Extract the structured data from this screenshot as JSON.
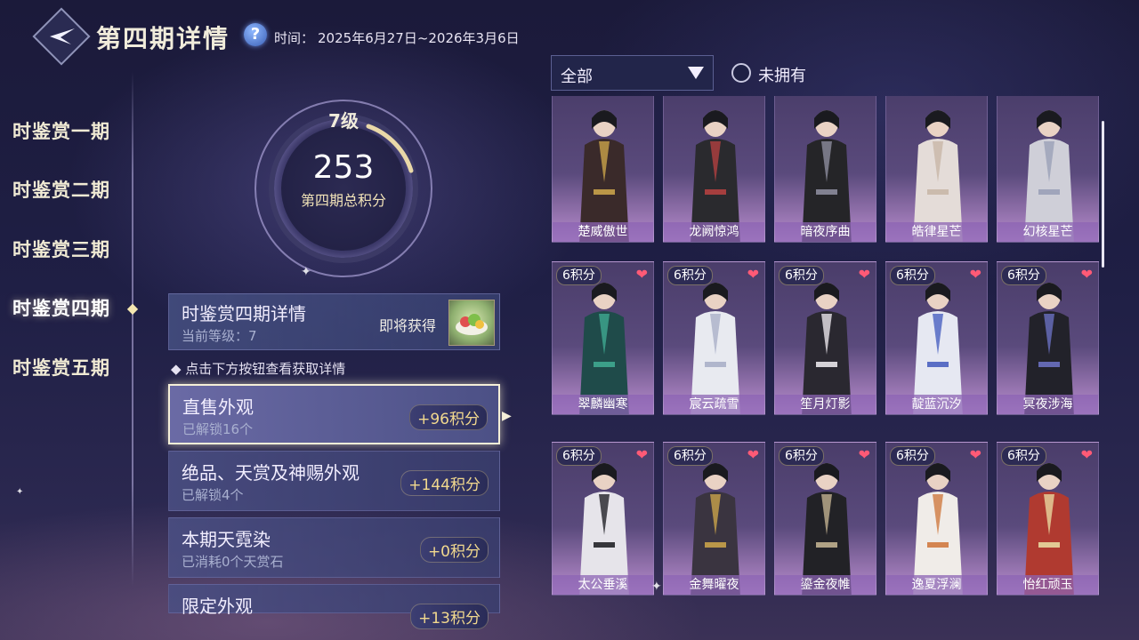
{
  "header": {
    "title": "第四期详情",
    "help_icon": "?",
    "time_label": "时间：",
    "time_range": "2025年6月27日~2026年3月6日"
  },
  "periods": [
    {
      "label": "时鉴赏一期",
      "active": false
    },
    {
      "label": "时鉴赏二期",
      "active": false
    },
    {
      "label": "时鉴赏三期",
      "active": false
    },
    {
      "label": "时鉴赏四期",
      "active": true
    },
    {
      "label": "时鉴赏五期",
      "active": false
    }
  ],
  "ring": {
    "level": "7级",
    "score": "253",
    "caption": "第四期总积分"
  },
  "detail": {
    "title": "时鉴赏四期详情",
    "sub": "当前等级：7",
    "soon": "即将获得",
    "reward_icon": "food-plate-icon"
  },
  "hint": "◆ 点击下方按钮查看获取详情",
  "categories": [
    {
      "title": "直售外观",
      "sub": "已解锁16个",
      "badge": "+96积分",
      "selected": true
    },
    {
      "title": "绝品、天赏及神赐外观",
      "sub": "已解锁4个",
      "badge": "+144积分",
      "selected": false
    },
    {
      "title": "本期天霓染",
      "sub": "已消耗0个天赏石",
      "badge": "+0积分",
      "selected": false
    },
    {
      "title": "限定外观",
      "sub": "",
      "badge": "+13积分",
      "selected": false
    }
  ],
  "filter": {
    "value": "全部",
    "radio_label": "未拥有"
  },
  "grid": {
    "rows": [
      [
        {
          "name": "楚威傲世",
          "points": "",
          "outfit": "#3a2a2a",
          "accent": "#c9a24a"
        },
        {
          "name": "龙阙惊鸿",
          "points": "",
          "outfit": "#2a2a2e",
          "accent": "#b24040"
        },
        {
          "name": "暗夜序曲",
          "points": "",
          "outfit": "#252528",
          "accent": "#8c8c9c"
        },
        {
          "name": "皓律星芒",
          "points": "",
          "outfit": "#e4dcd8",
          "accent": "#c8b7a8"
        },
        {
          "name": "幻核星芒",
          "points": "",
          "outfit": "#cfcfd8",
          "accent": "#9aa0b8"
        }
      ],
      [
        {
          "name": "翠麟幽寒",
          "points": "6积分",
          "outfit": "#1f4b4a",
          "accent": "#3fa890"
        },
        {
          "name": "宸云疏雪",
          "points": "6积分",
          "outfit": "#e8eaf0",
          "accent": "#aab0c8"
        },
        {
          "name": "笙月灯影",
          "points": "6积分",
          "outfit": "#2a2830",
          "accent": "#e8e4ea"
        },
        {
          "name": "靛蓝沉汐",
          "points": "6积分",
          "outfit": "#e6e8f2",
          "accent": "#4a60c0"
        },
        {
          "name": "冥夜涉海",
          "points": "6积分",
          "outfit": "#22222a",
          "accent": "#6a70c0"
        }
      ],
      [
        {
          "name": "太公垂溪",
          "points": "6积分",
          "outfit": "#e6e4ea",
          "accent": "#222228"
        },
        {
          "name": "金舞曜夜",
          "points": "6积分",
          "outfit": "#3a3440",
          "accent": "#c9a24a"
        },
        {
          "name": "鎏金夜帷",
          "points": "6积分",
          "outfit": "#222226",
          "accent": "#c0b090"
        },
        {
          "name": "逸夏浮澜",
          "points": "6积分",
          "outfit": "#f0ece8",
          "accent": "#d07a40"
        },
        {
          "name": "怡红顽玉",
          "points": "6积分",
          "outfit": "#b03a30",
          "accent": "#e8d8a0"
        }
      ]
    ]
  },
  "colors": {
    "accent_gold": "#f2d98e",
    "heart": "#ff5a76",
    "panel": "#4a4e82"
  }
}
